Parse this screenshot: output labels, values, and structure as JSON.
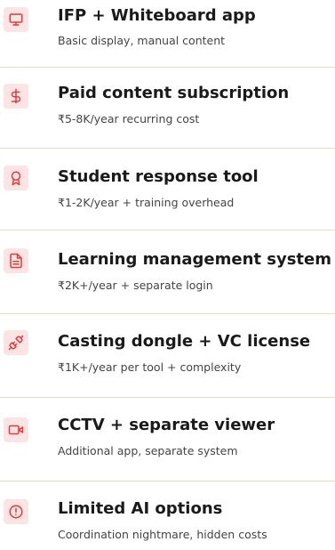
{
  "colors": {
    "icon_background": "#fde4e4",
    "icon_stroke": "#e03a3a",
    "divider": "#d6e2c9"
  },
  "items": [
    {
      "icon": "monitor-icon",
      "title": "IFP + Whiteboard app",
      "description": "Basic display, manual content"
    },
    {
      "icon": "dollar-icon",
      "title": "Paid content subscription",
      "description": "₹5-8K/year recurring cost"
    },
    {
      "icon": "award-icon",
      "title": "Student response tool",
      "description": "₹1-2K/year + training overhead"
    },
    {
      "icon": "file-text-icon",
      "title": "Learning management system",
      "description": "₹2K+/year + separate login"
    },
    {
      "icon": "unplug-icon",
      "title": "Casting dongle + VC license",
      "description": "₹1K+/year per tool + complexity"
    },
    {
      "icon": "video-icon",
      "title": "CCTV + separate viewer",
      "description": "Additional app, separate system"
    },
    {
      "icon": "alert-circle-icon",
      "title": "Limited AI options",
      "description": "Coordination nightmare, hidden costs"
    }
  ]
}
